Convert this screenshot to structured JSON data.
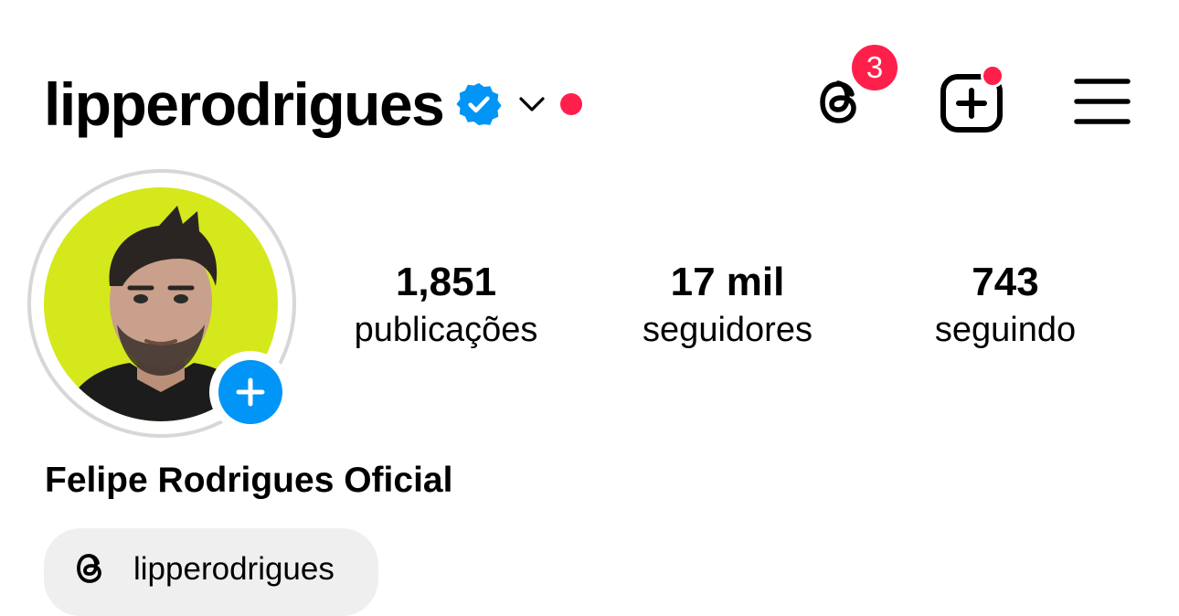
{
  "header": {
    "username": "lipperodrigues",
    "threads_badge_count": "3",
    "icons": {
      "verified": "verified-badge-icon",
      "account_switcher": "chevron-down-icon",
      "threads": "threads-icon",
      "create": "plus-square-icon",
      "menu": "hamburger-menu-icon"
    }
  },
  "profile": {
    "display_name": "Felipe Rodrigues Oficial",
    "avatar_icon": "add-story-plus-icon",
    "stats": [
      {
        "value": "1,851",
        "label": "publicações"
      },
      {
        "value": "17 mil",
        "label": "seguidores"
      },
      {
        "value": "743",
        "label": "seguindo"
      }
    ],
    "threads_link": {
      "label": "lipperodrigues",
      "icon": "threads-icon"
    }
  },
  "colors": {
    "accent_blue": "#0095f6",
    "notification_red": "#ff1f4b",
    "avatar_background": "#d4e81c",
    "chip_background": "#efefef"
  }
}
